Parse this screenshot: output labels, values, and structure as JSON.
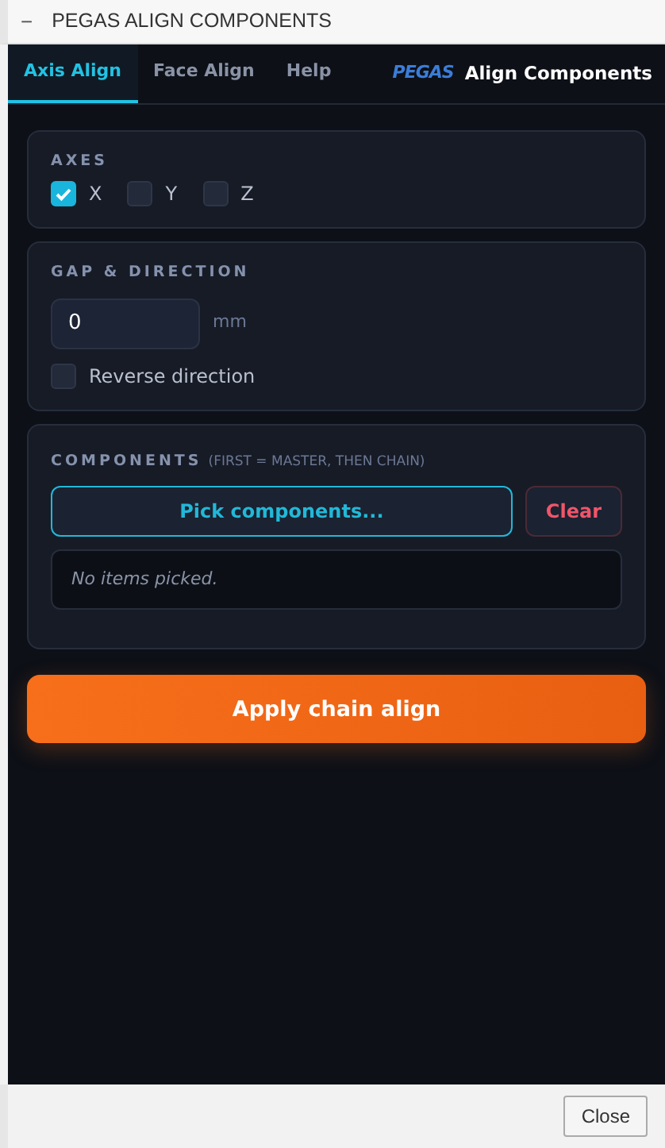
{
  "window": {
    "title": "PEGAS ALIGN COMPONENTS",
    "minimize": "−"
  },
  "tabs": [
    {
      "label": "Axis Align",
      "selected": true
    },
    {
      "label": "Face Align",
      "selected": false
    },
    {
      "label": "Help",
      "selected": false
    }
  ],
  "brand": {
    "logo": "PEGAS",
    "title": "Align Components"
  },
  "axes": {
    "heading": "AXES",
    "options": [
      {
        "label": "X",
        "checked": true
      },
      {
        "label": "Y",
        "checked": false
      },
      {
        "label": "Z",
        "checked": false
      }
    ]
  },
  "gap": {
    "heading": "GAP & DIRECTION",
    "value": "0",
    "unit": "mm",
    "reverse": {
      "label": "Reverse direction",
      "checked": false
    }
  },
  "components": {
    "heading": "COMPONENTS",
    "note": "(FIRST = MASTER, THEN CHAIN)",
    "pick_button": "Pick components...",
    "clear_button": "Clear",
    "empty_text": "No items picked."
  },
  "apply_button": "Apply chain align",
  "footer": {
    "close_button": "Close"
  }
}
